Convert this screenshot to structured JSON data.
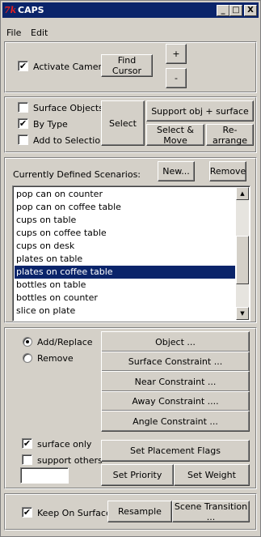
{
  "window": {
    "title": "CAPS",
    "app_icon": "7k",
    "minimize": "_",
    "maximize": "□",
    "close": "X"
  },
  "menu": {
    "file": "File",
    "edit": "Edit"
  },
  "camera": {
    "activate_label": "Activate Camera",
    "activate_checked": "✔",
    "find_cursor": "Find Cursor",
    "plus": "+",
    "minus": "-"
  },
  "selection": {
    "surface_objects": "Surface Objects",
    "by_type": "By Type",
    "by_type_checked": "✔",
    "add_to_selection": "Add to Selection",
    "select": "Select",
    "support_obj_surface": "Support obj + surface",
    "select_move": "Select & Move",
    "rearrange": "Re-arrange"
  },
  "scenarios": {
    "label": "Currently Defined Scenarios:",
    "new": "New...",
    "remove": "Remove",
    "items": [
      "pop can on counter",
      "pop can on coffee table",
      "cups on table",
      "cups on coffee table",
      "cups on desk",
      "plates on table",
      "plates on coffee table",
      "bottles on table",
      "bottles on counter",
      "slice on plate"
    ],
    "selected": "plates on coffee table"
  },
  "constraints": {
    "add_replace": "Add/Replace",
    "remove": "Remove",
    "object": "Object ...",
    "surface_constraint": "Surface Constraint ...",
    "near_constraint": "Near Constraint ...",
    "away_constraint": "Away Constraint ....",
    "angle_constraint": "Angle Constraint ...",
    "surface_only": "surface only",
    "surface_only_checked": "✔",
    "support_others": "support others",
    "set_placement_flags": "Set Placement Flags",
    "set_priority": "Set Priority",
    "set_weight": "Set Weight"
  },
  "bottom": {
    "keep_on_surface": "Keep On Surface",
    "keep_checked": "✔",
    "resample": "Resample",
    "scene_transition": "Scene Transition ..."
  }
}
